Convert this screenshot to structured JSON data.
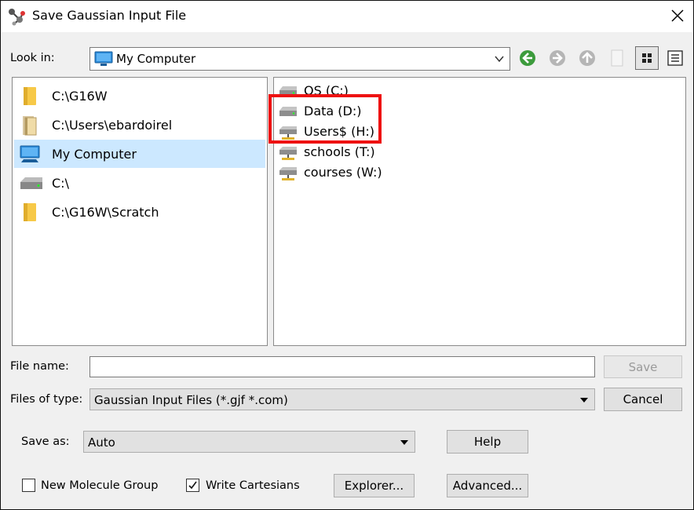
{
  "window": {
    "title": "Save Gaussian Input File"
  },
  "lookin": {
    "label": "Look in:",
    "value": "My Computer"
  },
  "toolbar": {
    "back": "back-arrow-icon",
    "forward": "forward-arrow-icon",
    "up": "up-arrow-icon",
    "new_folder": "new-folder-icon",
    "list_view": "list-view-icon",
    "details_view": "details-view-icon"
  },
  "places": [
    {
      "label": "C:\\G16W",
      "icon": "folder-icon"
    },
    {
      "label": "C:\\Users\\ebardoirel",
      "icon": "user-folder-icon"
    },
    {
      "label": "My Computer",
      "icon": "computer-icon",
      "selected": true
    },
    {
      "label": "C:\\",
      "icon": "drive-icon"
    },
    {
      "label": "C:\\G16W\\Scratch",
      "icon": "folder-icon"
    }
  ],
  "drives": [
    {
      "label": "OS (C:)",
      "icon": "drive-icon"
    },
    {
      "label": "Data (D:)",
      "icon": "drive-icon"
    },
    {
      "label": "Users$ (H:)",
      "icon": "network-drive-icon"
    },
    {
      "label": "schools (T:)",
      "icon": "network-drive-icon"
    },
    {
      "label": "courses (W:)",
      "icon": "network-drive-icon"
    }
  ],
  "filename": {
    "label": "File name:",
    "value": "",
    "save_button": "Save"
  },
  "filetype": {
    "label": "Files of type:",
    "value": "Gaussian Input Files (*.gjf *.com)",
    "cancel_button": "Cancel"
  },
  "saveas": {
    "label": "Save as:",
    "value": "Auto",
    "help_button": "Help"
  },
  "options": {
    "new_molecule_group": {
      "label": "New Molecule Group",
      "checked": false
    },
    "write_cartesians": {
      "label": "Write Cartesians",
      "checked": true
    },
    "explorer_button": "Explorer...",
    "advanced_button": "Advanced..."
  },
  "colors": {
    "highlight": "#ee1111",
    "selection": "#cce8ff",
    "accent": "#3c9b3c"
  }
}
